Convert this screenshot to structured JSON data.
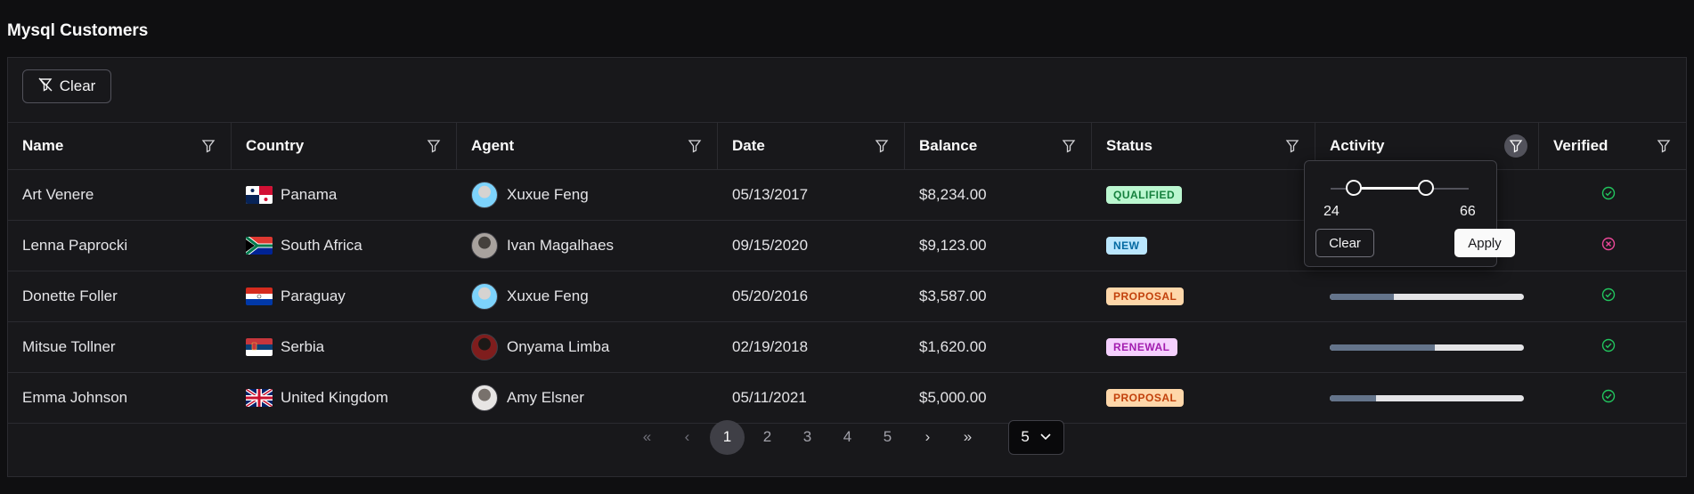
{
  "page": {
    "title": "Mysql Customers"
  },
  "toolbar": {
    "clear_label": "Clear",
    "clear_icon": "filter-slash-icon"
  },
  "columns": [
    {
      "label": "Name"
    },
    {
      "label": "Country"
    },
    {
      "label": "Agent"
    },
    {
      "label": "Date"
    },
    {
      "label": "Balance"
    },
    {
      "label": "Status"
    },
    {
      "label": "Activity"
    },
    {
      "label": "Verified"
    }
  ],
  "rows": [
    {
      "name": "Art Venere",
      "country": "Panama",
      "agent": "Xuxue Feng",
      "date": "05/13/2017",
      "balance": "$8,234.00",
      "status": "QUALIFIED",
      "activity": null,
      "verified": true
    },
    {
      "name": "Lenna Paprocki",
      "country": "South Africa",
      "agent": "Ivan Magalhaes",
      "date": "09/15/2020",
      "balance": "$9,123.00",
      "status": "NEW",
      "activity": null,
      "verified": false
    },
    {
      "name": "Donette Foller",
      "country": "Paraguay",
      "agent": "Xuxue Feng",
      "date": "05/20/2016",
      "balance": "$3,587.00",
      "status": "PROPOSAL",
      "activity": 0.33,
      "verified": true
    },
    {
      "name": "Mitsue Tollner",
      "country": "Serbia",
      "agent": "Onyama Limba",
      "date": "02/19/2018",
      "balance": "$1,620.00",
      "status": "RENEWAL",
      "activity": 0.54,
      "verified": true
    },
    {
      "name": "Emma Johnson",
      "country": "United Kingdom",
      "agent": "Amy Elsner",
      "date": "05/11/2021",
      "balance": "$5,000.00",
      "status": "PROPOSAL",
      "activity": 0.24,
      "verified": true
    }
  ],
  "status_colors": {
    "QUALIFIED": {
      "bg": "#bbf7d0",
      "fg": "#15803d"
    },
    "NEW": {
      "bg": "#bae6fd",
      "fg": "#0369a1"
    },
    "PROPOSAL": {
      "bg": "#fed7aa",
      "fg": "#c2410c"
    },
    "RENEWAL": {
      "bg": "#f5d0fe",
      "fg": "#a21caf"
    }
  },
  "activity_filter": {
    "min": "24",
    "max": "66",
    "clear_label": "Clear",
    "apply_label": "Apply"
  },
  "pagination": {
    "pages": [
      "1",
      "2",
      "3",
      "4",
      "5"
    ],
    "current": "1",
    "rows_per_page": "5"
  }
}
